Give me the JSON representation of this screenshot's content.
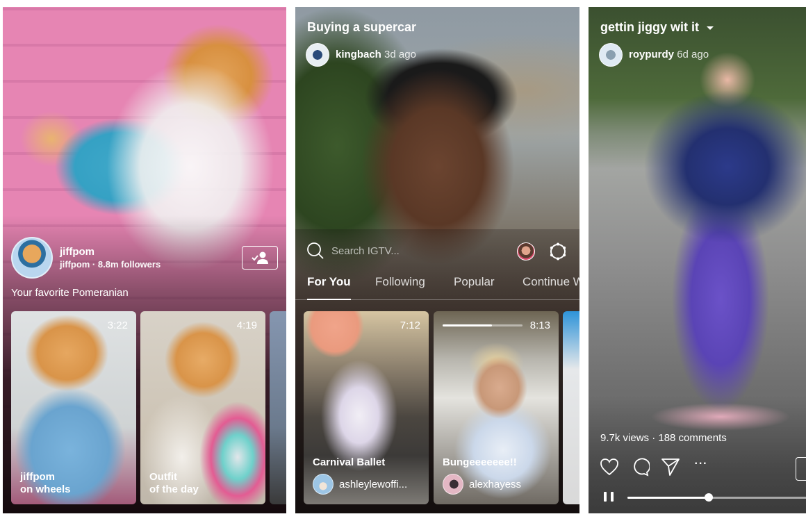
{
  "panels": [
    {
      "channel": {
        "name": "jiffpom",
        "subtitle": "jiffpom · 8.8m followers",
        "description": "Your favorite Pomeranian",
        "follow_state": "following"
      },
      "videos": [
        {
          "caption": "jiffpom\non wheels",
          "duration": "3:22"
        },
        {
          "caption": "Outfit\nof the day",
          "duration": "4:19"
        }
      ]
    },
    {
      "title": "Buying a supercar",
      "author": {
        "name": "kingbach",
        "time": "3d ago"
      },
      "search": {
        "placeholder": "Search IGTV..."
      },
      "tabs": [
        {
          "label": "For You",
          "active": true
        },
        {
          "label": "Following",
          "active": false
        },
        {
          "label": "Popular",
          "active": false
        },
        {
          "label": "Continue Watching",
          "active": false
        }
      ],
      "videos": [
        {
          "title": "Carnival Ballet",
          "duration": "7:12",
          "author": "ashleylewoffi..."
        },
        {
          "title": "Bungeeeeeee!!",
          "duration": "8:13",
          "author": "alexhayess",
          "watched_fraction": 0.62
        }
      ]
    },
    {
      "title": "gettin jiggy wit it",
      "author": {
        "name": "roypurdy",
        "time": "6d ago"
      },
      "stats": "9.7k views · 188 comments",
      "actions": {
        "more_label": "···"
      },
      "playback": {
        "state": "playing",
        "progress_fraction": 0.45
      }
    }
  ]
}
